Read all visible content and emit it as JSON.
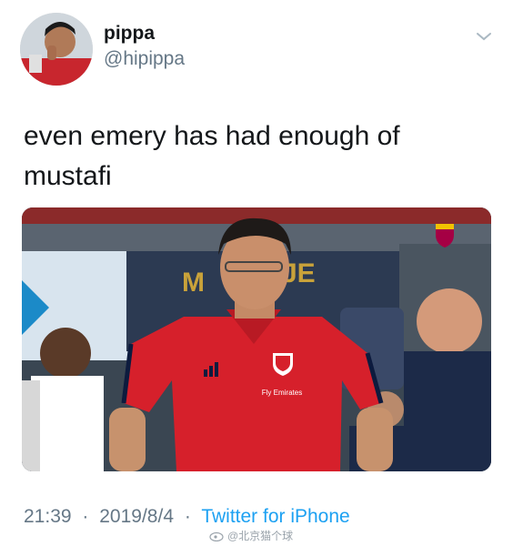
{
  "author": {
    "display_name": "pippa",
    "handle": "@hipippa",
    "avatar_icon": "profile-photo"
  },
  "tweet": {
    "text_line1": "even emery has had enough of",
    "text_line2": "mustafi"
  },
  "media": {
    "description_icon": "photo-man-in-red-shirt",
    "shirt_text": "Fly Emirates"
  },
  "meta": {
    "time": "21:39",
    "date": "2019/8/4",
    "separator": "·",
    "source": "Twitter for iPhone"
  },
  "watermark": {
    "text": "@北京猫个球"
  },
  "colors": {
    "link": "#1da1f2",
    "secondary_text": "#657786",
    "shirt_red": "#d6202b"
  }
}
